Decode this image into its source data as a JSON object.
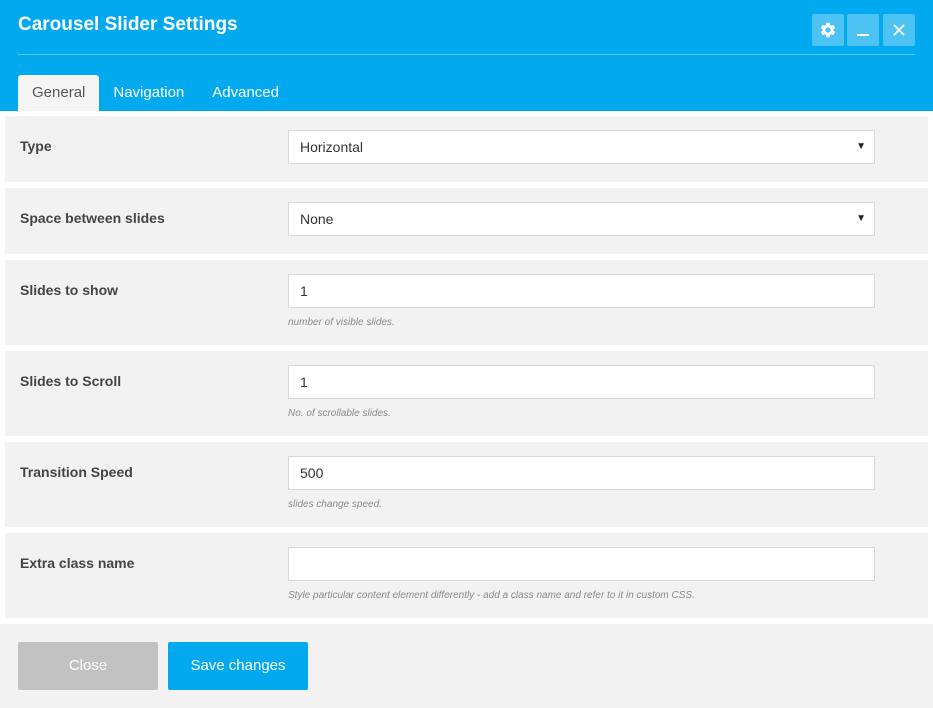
{
  "header": {
    "title": "Carousel Slider Settings",
    "icons": [
      "gear-icon",
      "minimize-icon",
      "close-icon"
    ]
  },
  "tabs": [
    {
      "label": "General",
      "active": true
    },
    {
      "label": "Navigation",
      "active": false
    },
    {
      "label": "Advanced",
      "active": false
    }
  ],
  "fields": {
    "type": {
      "label": "Type",
      "value": "Horizontal"
    },
    "space": {
      "label": "Space between slides",
      "value": "None"
    },
    "slides_show": {
      "label": "Slides to show",
      "value": "1",
      "hint": "number of visible slides."
    },
    "slides_scroll": {
      "label": "Slides to Scroll",
      "value": "1",
      "hint": "No. of scrollable slides."
    },
    "speed": {
      "label": "Transition Speed",
      "value": "500",
      "hint": "slides change speed."
    },
    "extra_class": {
      "label": "Extra class name",
      "value": "",
      "hint": "Style particular content element differently - add a class name and refer to it in custom CSS."
    }
  },
  "footer": {
    "close_label": "Close",
    "save_label": "Save changes"
  },
  "colors": {
    "accent": "#03a9ee",
    "row_bg": "#f2f2f2",
    "close_button": "#c2c2c2"
  }
}
